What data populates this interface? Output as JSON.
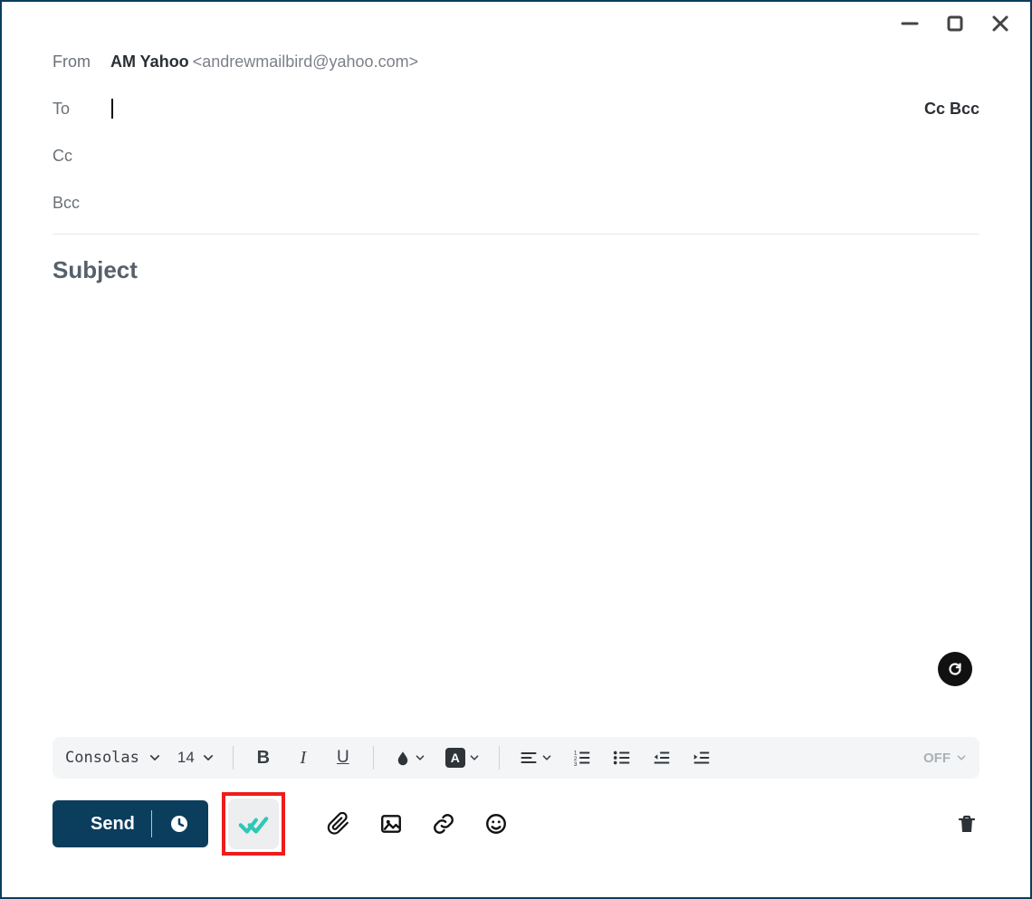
{
  "from": {
    "label": "From",
    "name": "AM Yahoo",
    "email": "<andrewmailbird@yahoo.com>"
  },
  "to": {
    "label": "To",
    "value": ""
  },
  "cc": {
    "label": "Cc",
    "value": ""
  },
  "bcc": {
    "label": "Bcc",
    "value": ""
  },
  "cc_bcc_toggle": "Cc Bcc",
  "subject": {
    "placeholder": "Subject",
    "value": ""
  },
  "body": {
    "value": ""
  },
  "format": {
    "font_family": "Consolas",
    "font_size": "14",
    "highlight_letter": "A",
    "off_label": "OFF"
  },
  "actions": {
    "send_label": "Send"
  },
  "icons": {
    "minimize": "minimize",
    "maximize": "maximize",
    "close": "close",
    "grammarly": "G"
  }
}
